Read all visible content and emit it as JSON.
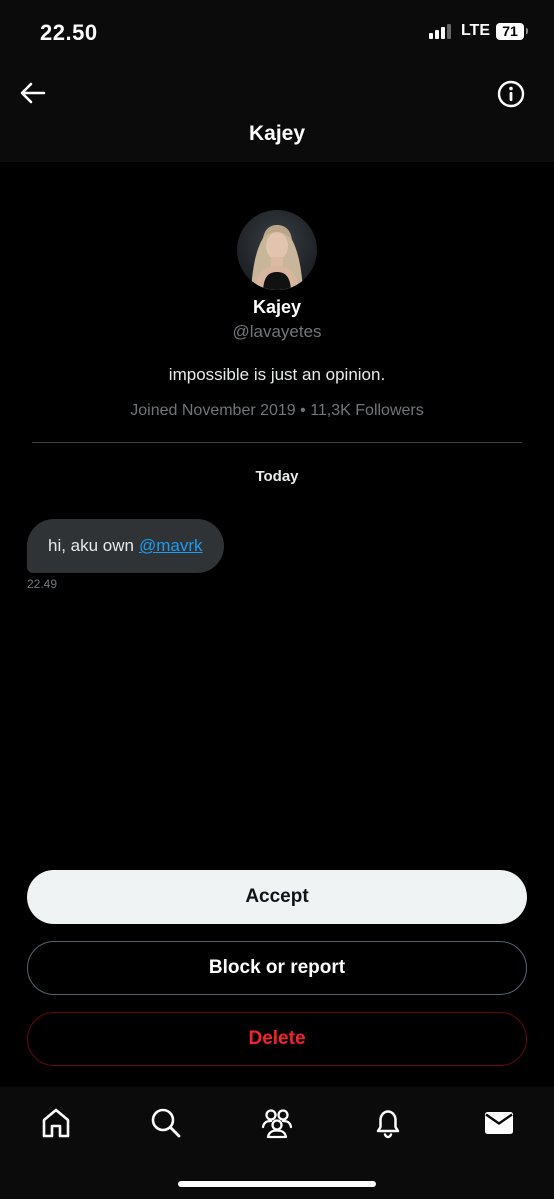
{
  "status_bar": {
    "time": "22.50",
    "network": "LTE",
    "battery": "71"
  },
  "header": {
    "title": "Kajey",
    "back_icon": "arrow-left-icon",
    "info_icon": "info-circle-icon"
  },
  "profile": {
    "name": "Kajey",
    "handle": "@lavayetes",
    "bio": "impossible is just an opinion.",
    "meta": "Joined November 2019 • 11,3K Followers"
  },
  "conversation": {
    "date_label": "Today",
    "messages": [
      {
        "text": "hi, aku own",
        "mention": "@mavrk",
        "time": "22.49"
      }
    ]
  },
  "actions": {
    "accept": "Accept",
    "block_report": "Block or report",
    "delete": "Delete"
  },
  "tab_bar": {
    "icons": [
      "home-icon",
      "search-icon",
      "communities-icon",
      "notifications-bell-icon",
      "messages-envelope-icon"
    ]
  },
  "colors": {
    "background": "#000000",
    "bubble": "#2f3336",
    "link": "#1d9bf0",
    "danger": "#f4212e",
    "accept_bg": "#eff3f4",
    "muted": "#71767b"
  }
}
